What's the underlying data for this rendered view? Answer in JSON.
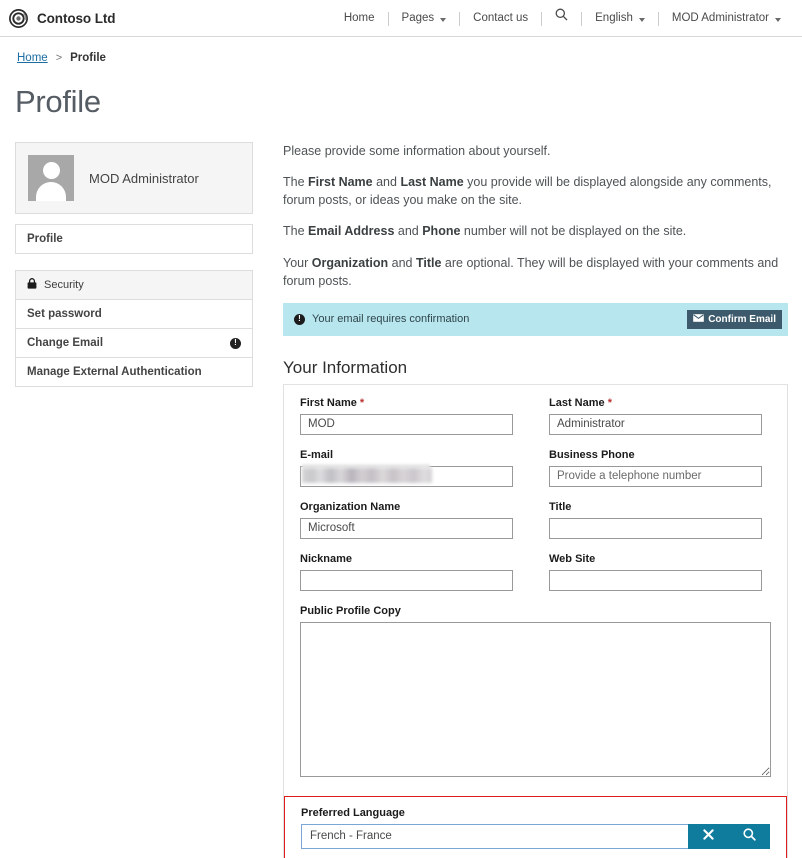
{
  "navbar": {
    "brand": "Contoso Ltd",
    "brand_logo_icon": "contoso-ring-logo",
    "items": [
      {
        "label": "Home",
        "caret": false,
        "icon": null
      },
      {
        "label": "Pages",
        "caret": true,
        "icon": null
      },
      {
        "label": "Contact us",
        "caret": false,
        "icon": null
      },
      {
        "label": "",
        "caret": false,
        "icon": "search-icon"
      },
      {
        "label": "English",
        "caret": true,
        "icon": null
      },
      {
        "label": "MOD Administrator",
        "caret": true,
        "icon": null
      }
    ]
  },
  "breadcrumb": {
    "home": "Home",
    "separator": ">",
    "current": "Profile"
  },
  "page": {
    "title": "Profile"
  },
  "sidebar": {
    "profile_card": {
      "name": "MOD Administrator",
      "avatar_icon": "user-avatar-placeholder"
    },
    "nav_primary": [
      {
        "label": "Profile",
        "icon": null,
        "badge": null
      }
    ],
    "nav_security": [
      {
        "label": "Security",
        "icon": "lock-icon",
        "badge": null,
        "is_header": true
      },
      {
        "label": "Set password",
        "icon": null,
        "badge": null,
        "is_header": false
      },
      {
        "label": "Change Email",
        "icon": null,
        "badge": "!",
        "is_header": false
      },
      {
        "label": "Manage External Authentication",
        "icon": null,
        "badge": null,
        "is_header": false
      }
    ]
  },
  "intro": {
    "p1": "Please provide some information about yourself.",
    "p2_a": "The ",
    "p2_b1": "First Name",
    "p2_c": " and ",
    "p2_b2": "Last Name",
    "p2_d": " you provide will be displayed alongside any comments, forum posts, or ideas you make on the site.",
    "p3_a": "The ",
    "p3_b1": "Email Address",
    "p3_c": " and ",
    "p3_b2": "Phone",
    "p3_d": " number will not be displayed on the site.",
    "p4_a": "Your ",
    "p4_b1": "Organization",
    "p4_c": " and ",
    "p4_b2": "Title",
    "p4_d": " are optional. They will be displayed with your comments and forum posts."
  },
  "alert": {
    "icon": "exclamation-circle-icon",
    "message": "Your email requires confirmation",
    "button_label": "Confirm Email",
    "button_icon": "envelope-icon",
    "background_color": "#b8e6ef",
    "button_color": "#3d5a6c"
  },
  "form": {
    "section_title": "Your Information",
    "fields": {
      "first_name": {
        "label": "First Name",
        "required": true,
        "value": "MOD",
        "placeholder": ""
      },
      "last_name": {
        "label": "Last Name",
        "required": true,
        "value": "Administrator",
        "placeholder": ""
      },
      "email": {
        "label": "E-mail",
        "required": false,
        "value": "",
        "placeholder": "",
        "redacted": true
      },
      "business_phone": {
        "label": "Business Phone",
        "required": false,
        "value": "",
        "placeholder": "Provide a telephone number"
      },
      "organization_name": {
        "label": "Organization Name",
        "required": false,
        "value": "Microsoft",
        "placeholder": ""
      },
      "title": {
        "label": "Title",
        "required": false,
        "value": "",
        "placeholder": ""
      },
      "nickname": {
        "label": "Nickname",
        "required": false,
        "value": "",
        "placeholder": ""
      },
      "web_site": {
        "label": "Web Site",
        "required": false,
        "value": "",
        "placeholder": ""
      },
      "public_profile_copy": {
        "label": "Public Profile Copy",
        "required": false,
        "value": "",
        "placeholder": ""
      },
      "preferred_language": {
        "label": "Preferred Language",
        "required": false,
        "value": "French - France",
        "placeholder": "",
        "clear_icon": "clear-x-icon",
        "search_icon": "search-icon",
        "button_color": "#0f7c9e",
        "highlight_color": "#e01b1b"
      }
    },
    "required_marker": "*"
  }
}
